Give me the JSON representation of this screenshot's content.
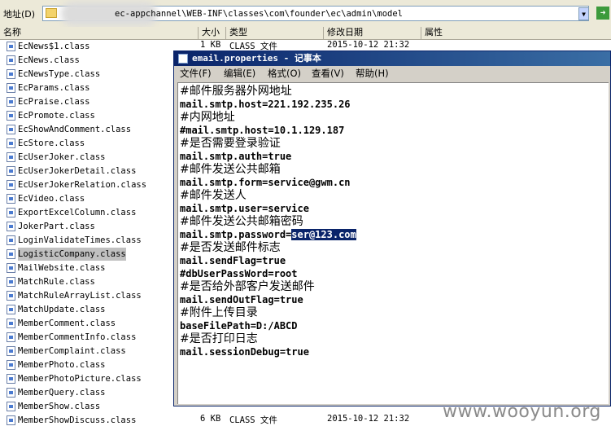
{
  "address_bar": {
    "label": "地址(D)",
    "path": "ec-appchannel\\WEB-INF\\classes\\com\\founder\\ec\\admin\\model",
    "go_label": "➜"
  },
  "columns": {
    "name": "名称",
    "size": "大小",
    "type": "类型",
    "modified": "修改日期",
    "attributes": "属性"
  },
  "first_row": {
    "size": "1 KB",
    "type": "CLASS 文件",
    "modified": "2015-10-12 21:32"
  },
  "last_row": {
    "size": "6 KB",
    "type": "CLASS 文件",
    "modified": "2015-10-12 21:32"
  },
  "files": [
    "EcNews$1.class",
    "EcNews.class",
    "EcNewsType.class",
    "EcParams.class",
    "EcPraise.class",
    "EcPromote.class",
    "EcShowAndComment.class",
    "EcStore.class",
    "EcUserJoker.class",
    "EcUserJokerDetail.class",
    "EcUserJokerRelation.class",
    "EcVideo.class",
    "ExportExcelColumn.class",
    "JokerPart.class",
    "LoginValidateTimes.class",
    "LogisticCompany.class",
    "MailWebsite.class",
    "MatchRule.class",
    "MatchRuleArrayList.class",
    "MatchUpdate.class",
    "MemberComment.class",
    "MemberCommentInfo.class",
    "MemberComplaint.class",
    "MemberPhoto.class",
    "MemberPhotoPicture.class",
    "MemberQuery.class",
    "MemberShow.class",
    "MemberShowDiscuss.class"
  ],
  "selected_file_index": 15,
  "notepad": {
    "title": "email.properties - 记事本",
    "menu": [
      "文件(F)",
      "编辑(E)",
      "格式(O)",
      "查看(V)",
      "帮助(H)"
    ],
    "lines": [
      "#邮件服务器外网地址",
      "mail.smtp.host=221.192.235.26",
      "#内网地址",
      "#mail.smtp.host=10.1.129.187",
      "#是否需要登录验证",
      "mail.smtp.auth=true",
      "#邮件发送公共邮箱",
      "mail.smtp.form=service@gwm.cn",
      "#邮件发送人",
      "mail.smtp.user=service",
      "#邮件发送公共邮箱密码",
      "mail.smtp.password=",
      "#是否发送邮件标志",
      "mail.sendFlag=true",
      "#dbUserPassWord=root",
      "#是否给外部客户发送邮件",
      "mail.sendOutFlag=true",
      "#附件上传目录",
      "baseFilePath=D:/ABCD",
      "#是否打印日志",
      "mail.sessionDebug=true"
    ],
    "selected_text": "ser@123.com"
  },
  "watermark": "www.wooyun.org"
}
